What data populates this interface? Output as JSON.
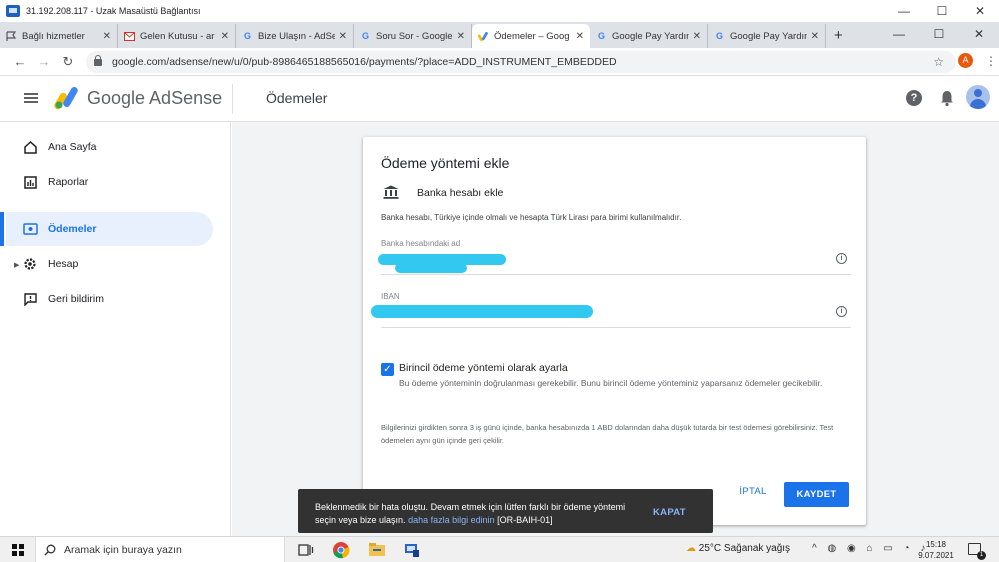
{
  "window": {
    "title": "31.192.208.117 - Uzak Masaüstü Bağlantısı",
    "controls": {
      "minimize": "—",
      "maximize": "☐",
      "close": "✕"
    }
  },
  "browser": {
    "tabs": [
      {
        "title": "Bağlı hizmetler",
        "favicon": "flag-icon",
        "active": false
      },
      {
        "title": "Gelen Kutusu - ar",
        "favicon": "gmail-icon",
        "active": false
      },
      {
        "title": "Bize Ulaşın - AdSe",
        "favicon": "google-icon",
        "active": false
      },
      {
        "title": "Soru Sor - Google",
        "favicon": "google-icon",
        "active": false
      },
      {
        "title": "Ödemeler – Goog",
        "favicon": "adsense-icon",
        "active": true
      },
      {
        "title": "Google Pay Yardım",
        "favicon": "google-icon",
        "active": false
      },
      {
        "title": "Google Pay Yardım",
        "favicon": "google-icon",
        "active": false
      }
    ],
    "tab_close": "✕",
    "new_tab": "+",
    "url": "google.com/adsense/new/u/0/pub-8986465188565016/payments/?place=ADD_INSTRUMENT_EMBEDDED",
    "profile_initial": "A"
  },
  "adsense": {
    "brand": "Google AdSense",
    "page_title": "Ödemeler",
    "help": "?"
  },
  "sidebar": {
    "items": [
      {
        "label": "Ana Sayfa",
        "icon": "home-icon",
        "active": false
      },
      {
        "label": "Raporlar",
        "icon": "reports-icon",
        "active": false
      },
      {
        "label": "Ödemeler",
        "icon": "payments-icon",
        "active": true
      },
      {
        "label": "Hesap",
        "icon": "gear-icon",
        "active": false
      },
      {
        "label": "Geri bildirim",
        "icon": "feedback-icon",
        "active": false
      }
    ]
  },
  "form": {
    "title": "Ödeme yöntemi ekle",
    "bank_label": "Banka hesabı ekle",
    "bank_info": "Banka hesabı, Türkiye içinde olmalı ve hesapta Türk Lirası para birimi kullanılmalıdır.",
    "account_name_label": "Banka hesabındaki ad",
    "account_name_value": "",
    "iban_label": "IBAN",
    "iban_value": "",
    "primary_checkbox_label": "Birincil ödeme yöntemi olarak ayarla",
    "primary_checked": true,
    "primary_desc": "Bu ödeme yönteminin doğrulanması gerekebilir. Bunu birincil ödeme yönteminiz yaparsanız ödemeler gecikebilir.",
    "notice": "Bilgilerinizi girdikten sonra 3 iş günü içinde, banka hesabınızda 1 ABD dolarından daha düşük tutarda bir test ödemesi görebilirsiniz. Test ödemeleri aynı gün içinde geri çekilir.",
    "cancel": "İPTAL",
    "save": "KAYDET"
  },
  "snackbar": {
    "message": "Beklenmedik bir hata oluştu. Devam etmek için lütfen farklı bir ödeme yöntemi seçin veya bize ulaşın.",
    "link": "daha fazla bilgi edinin",
    "code": "[OR-BAIH-01]",
    "action": "KAPAT"
  },
  "taskbar": {
    "search_placeholder": "Aramak için buraya yazın",
    "weather": "25°C  Sağanak yağış",
    "time": "15:18",
    "date": "9.07.2021",
    "notifications": "1"
  }
}
